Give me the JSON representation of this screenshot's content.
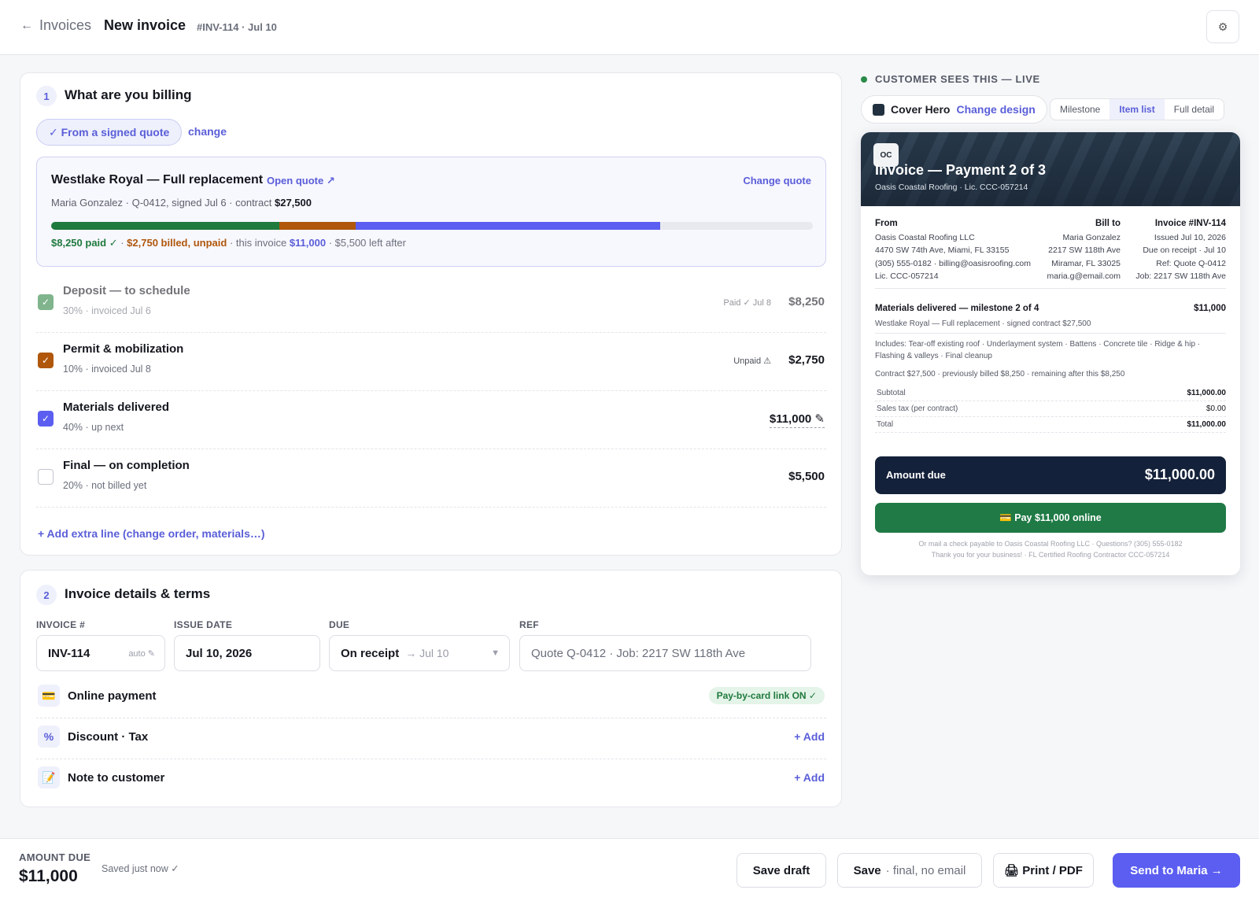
{
  "header": {
    "back_arrow": "←",
    "back_label": "Invoices",
    "title": "New invoice",
    "meta": "#INV-114 · Jul 10",
    "settings_icon": "⚙"
  },
  "section1": {
    "step": "1",
    "title": "What are you billing",
    "source_pill": "✓ From a signed quote",
    "change_label": "change",
    "quote": {
      "title": "Westlake Royal — Full replacement",
      "open_label": "Open quote ↗",
      "change_label": "Change quote",
      "sub_prefix": "Maria Gonzalez · Q-0412, signed Jul 6 · contract",
      "contract": "$27,500",
      "progress": {
        "paid_pct": 30,
        "billed_unpaid_pct": 10,
        "this_invoice_pct": 40,
        "colors": {
          "paid": "#1f7a3d",
          "unpaid": "#b0570b",
          "this": "#5b5ef0"
        }
      },
      "legend_paid": "$8,250 paid ✓",
      "legend_sep1": " · ",
      "legend_unpaid": "$2,750 billed, unpaid",
      "legend_mid": " · this invoice ",
      "legend_this": "$11,000",
      "legend_left": " · $5,500 left after"
    },
    "milestones": [
      {
        "name": "Deposit — to schedule",
        "sub": "30% · invoiced Jul 6",
        "status": "Paid ✓ Jul 8",
        "amount": "$8,250",
        "check": "✓"
      },
      {
        "name": "Permit & mobilization",
        "sub": "10% · invoiced Jul 8",
        "status": "Unpaid ⚠",
        "amount": "$2,750",
        "check": "✓"
      },
      {
        "name": "Materials delivered",
        "sub": "40% · up next",
        "status": "",
        "amount": "$11,000 ✎",
        "check": "✓"
      },
      {
        "name": "Final — on completion",
        "sub": "20% · not billed yet",
        "status": "",
        "amount": "$5,500",
        "check": ""
      }
    ],
    "add_line": "+ Add extra line (change order, materials…)"
  },
  "section2": {
    "step": "2",
    "title": "Invoice details & terms",
    "labels": {
      "invoice": "INVOICE #",
      "issue": "ISSUE DATE",
      "due": "DUE",
      "ref": "REF"
    },
    "invoice_no": "INV-114",
    "auto_label": "auto ✎",
    "issue_date": "Jul 10, 2026",
    "due_value": "On receipt",
    "due_arrow_date": "→ Jul 10",
    "due_caret": "▼",
    "ref_placeholder": "Quote Q-0412 · Job: 2217 SW 118th Ave",
    "options": [
      {
        "icon": "💳",
        "label": "Online payment",
        "badge": "Pay-by-card link ON ✓",
        "add": ""
      },
      {
        "icon": "%",
        "label": "Discount · Tax",
        "badge": "",
        "add": "+ Add"
      },
      {
        "icon": "📝",
        "label": "Note to customer",
        "badge": "",
        "add": "+ Add"
      }
    ]
  },
  "preview": {
    "live_label": "CUSTOMER SEES THIS — LIVE",
    "design_name": "Cover Hero",
    "change_design": "Change design",
    "modes": [
      "Milestone",
      "Item list",
      "Full detail"
    ],
    "active_mode": "Item list",
    "badge": "OC",
    "hero_title": "Invoice — Payment 2 of 3",
    "hero_sub": "Oasis Coastal Roofing · Lic. CCC-057214",
    "from": {
      "h": "From",
      "lines": [
        "Oasis Coastal Roofing LLC",
        "4470 SW 74th Ave, Miami, FL 33155",
        "(305) 555-0182 · billing@oasisroofing.com",
        "Lic. CCC-057214"
      ]
    },
    "bill_to": {
      "h": "Bill to",
      "lines": [
        "Maria Gonzalez",
        "2217 SW 118th Ave",
        "Miramar, FL 33025",
        "maria.g@email.com"
      ]
    },
    "invoice": {
      "h": "Invoice #INV-114",
      "lines": [
        "Issued Jul 10, 2026",
        "Due on receipt · Jul 10",
        "Ref: Quote Q-0412",
        "Job: 2217 SW 118th Ave"
      ]
    },
    "ms_title": "Materials delivered — milestone 2 of 4",
    "ms_amount": "$11,000",
    "ms_sub": "Westlake Royal — Full replacement · signed contract $27,500",
    "includes": "Includes: Tear-off existing roof · Underlayment system · Battens · Concrete tile · Ridge & hip · Flashing & valleys · Final cleanup",
    "contract_line": "Contract $27,500 · previously billed $8,250 · remaining after this $8,250",
    "totals": [
      {
        "label": "Subtotal",
        "value": "$11,000.00"
      },
      {
        "label": "Sales tax (per contract)",
        "value": "$0.00"
      },
      {
        "label": "Total",
        "value": "$11,000.00"
      }
    ],
    "amount_due_label": "Amount due",
    "amount_due_value": "$11,000.00",
    "pay_button": "💳 Pay $11,000 online",
    "footer1": "Or mail a check payable to Oasis Coastal Roofing LLC · Questions? (305) 555-0182",
    "footer2": "Thank you for your business! · FL Certified Roofing Contractor CCC-057214"
  },
  "bottom": {
    "amount_label": "AMOUNT DUE",
    "amount": "$11,000",
    "saved": "Saved just now ✓",
    "save_draft": "Save draft",
    "save_final": "Save",
    "save_final_sub": "· final, no email",
    "print": "🖨 Print / PDF",
    "send": "Send to Maria →"
  }
}
